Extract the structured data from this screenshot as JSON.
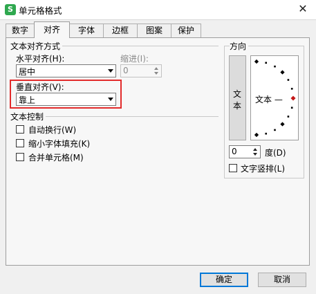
{
  "window": {
    "title": "单元格格式",
    "app_icon_letter": "S",
    "close_glyph": "✕"
  },
  "tabs": [
    {
      "label": "数字",
      "active": false
    },
    {
      "label": "对齐",
      "active": true
    },
    {
      "label": "字体",
      "active": false
    },
    {
      "label": "边框",
      "active": false
    },
    {
      "label": "图案",
      "active": false
    },
    {
      "label": "保护",
      "active": false
    }
  ],
  "text_alignment": {
    "group_title": "文本对齐方式",
    "horizontal": {
      "label": "水平对齐(H):",
      "value": "居中"
    },
    "indent": {
      "label": "缩进(I):",
      "value": "0",
      "enabled": false
    },
    "vertical": {
      "label": "垂直对齐(V):",
      "value": "靠上"
    }
  },
  "text_control": {
    "group_title": "文本控制",
    "options": [
      {
        "label": "自动换行(W)",
        "checked": false
      },
      {
        "label": "缩小字体填充(K)",
        "checked": false
      },
      {
        "label": "合并单元格(M)",
        "checked": false
      }
    ]
  },
  "orientation": {
    "group_title": "方向",
    "vertical_text_chars": [
      "文",
      "本"
    ],
    "horizontal_text": "文本 —",
    "degrees_value": "0",
    "degrees_label": "度(D)",
    "stacked_text_label": "文字竖排(L)",
    "stacked_text_checked": false
  },
  "buttons": {
    "ok": "确定",
    "cancel": "取消"
  },
  "colors": {
    "highlight": "#e22b2b",
    "accent": "#0078d7",
    "indicator": "#c41818"
  }
}
